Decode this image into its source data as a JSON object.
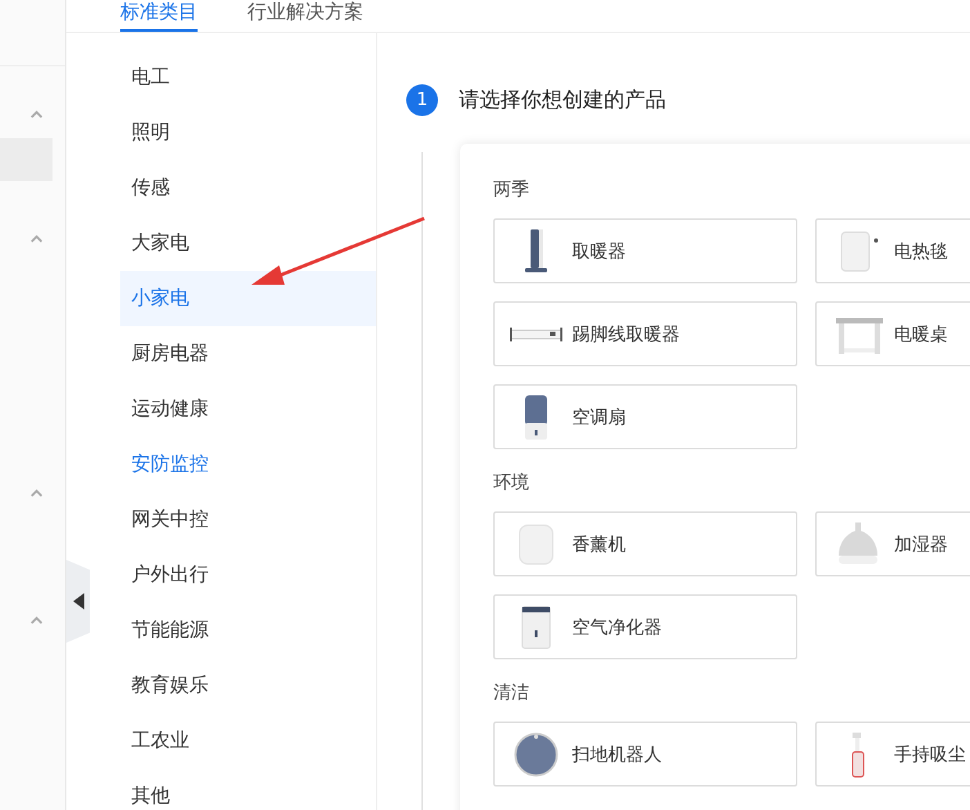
{
  "tabs": [
    {
      "label": "标准类目",
      "selected": true
    },
    {
      "label": "行业解决方案",
      "selected": false
    }
  ],
  "rail": {
    "sections": [
      {
        "expanded": true
      },
      {
        "expanded": true
      },
      {
        "expanded": true
      },
      {
        "expanded": true
      }
    ]
  },
  "categories": [
    {
      "label": "电工",
      "selected": false,
      "highlighted": false
    },
    {
      "label": "照明",
      "selected": false,
      "highlighted": false
    },
    {
      "label": "传感",
      "selected": false,
      "highlighted": false
    },
    {
      "label": "大家电",
      "selected": false,
      "highlighted": false
    },
    {
      "label": "小家电",
      "selected": true,
      "highlighted": false
    },
    {
      "label": "厨房电器",
      "selected": false,
      "highlighted": false
    },
    {
      "label": "运动健康",
      "selected": false,
      "highlighted": false
    },
    {
      "label": "安防监控",
      "selected": false,
      "highlighted": true
    },
    {
      "label": "网关中控",
      "selected": false,
      "highlighted": false
    },
    {
      "label": "户外出行",
      "selected": false,
      "highlighted": false
    },
    {
      "label": "节能能源",
      "selected": false,
      "highlighted": false
    },
    {
      "label": "教育娱乐",
      "selected": false,
      "highlighted": false
    },
    {
      "label": "工农业",
      "selected": false,
      "highlighted": false
    },
    {
      "label": "其他",
      "selected": false,
      "highlighted": false
    }
  ],
  "step": {
    "number": "1",
    "title": "请选择你想创建的产品"
  },
  "groups": [
    {
      "title": "两季",
      "products": [
        {
          "name": "取暖器"
        },
        {
          "name": "电热毯"
        },
        {
          "name": "踢脚线取暖器"
        },
        {
          "name": "电暖桌"
        },
        {
          "name": "空调扇"
        }
      ]
    },
    {
      "title": "环境",
      "products": [
        {
          "name": "香薰机"
        },
        {
          "name": "加湿器"
        },
        {
          "name": "空气净化器"
        }
      ]
    },
    {
      "title": "清洁",
      "products": [
        {
          "name": "扫地机器人"
        },
        {
          "name": "手持吸尘"
        }
      ]
    }
  ]
}
